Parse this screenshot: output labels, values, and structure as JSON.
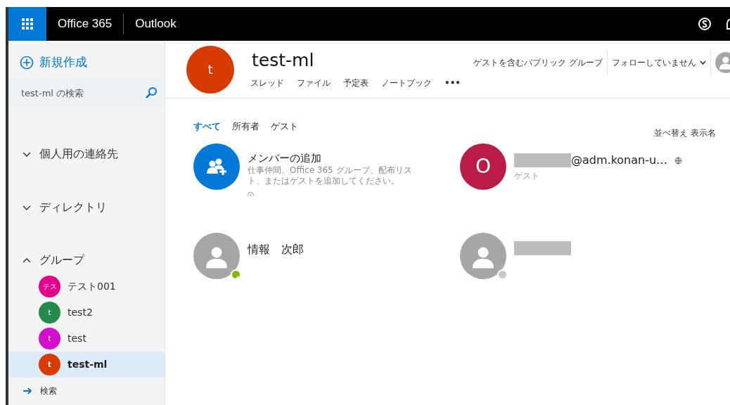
{
  "top_bar": {
    "brand": "Office 365",
    "app": "Outlook"
  },
  "sidebar": {
    "new_button": "新規作成",
    "search": {
      "placeholder": "test-ml の検索"
    },
    "sections": [
      {
        "label": "個人用の連絡先",
        "expanded": false
      },
      {
        "label": "ディレクトリ",
        "expanded": false
      },
      {
        "label": "グループ",
        "expanded": true,
        "items": [
          {
            "initials": "テス",
            "name": "テスト001",
            "color": "#e3008c",
            "selected": false
          },
          {
            "initials": "t",
            "name": "test2",
            "color": "#218a4c",
            "selected": false
          },
          {
            "initials": "t",
            "name": "test",
            "color": "#d40fcb",
            "selected": false
          },
          {
            "initials": "t",
            "name": "test-ml",
            "color": "#d83b01",
            "selected": true
          }
        ]
      }
    ],
    "search_link": "検索"
  },
  "group": {
    "initial": "t",
    "name": "test-ml",
    "color": "#d83b01",
    "tabs": [
      "スレッド",
      "ファイル",
      "予定表",
      "ノートブック",
      "•••"
    ],
    "privacy": "ゲストを含むパブリック グループ",
    "follow": "フォローしていません"
  },
  "filters": [
    {
      "label": "すべて",
      "selected": true
    },
    {
      "label": "所有者",
      "selected": false
    },
    {
      "label": "ゲスト",
      "selected": false
    }
  ],
  "sort": {
    "label": "並べ替え",
    "value": "表示名"
  },
  "members": [
    {
      "kind": "add",
      "title": "メンバーの追加",
      "description": "仕事仲間、Office 365 グループ、配布リスト、またはゲストを追加してください。"
    },
    {
      "kind": "guest",
      "initial": "O",
      "color": "#b91d47",
      "redacted": true,
      "name_suffix": "@adm.konan-u…",
      "subtitle": "ゲスト"
    },
    {
      "kind": "person",
      "name": "情報　次郎",
      "online": true
    },
    {
      "kind": "person",
      "redacted": true,
      "online": false
    }
  ]
}
